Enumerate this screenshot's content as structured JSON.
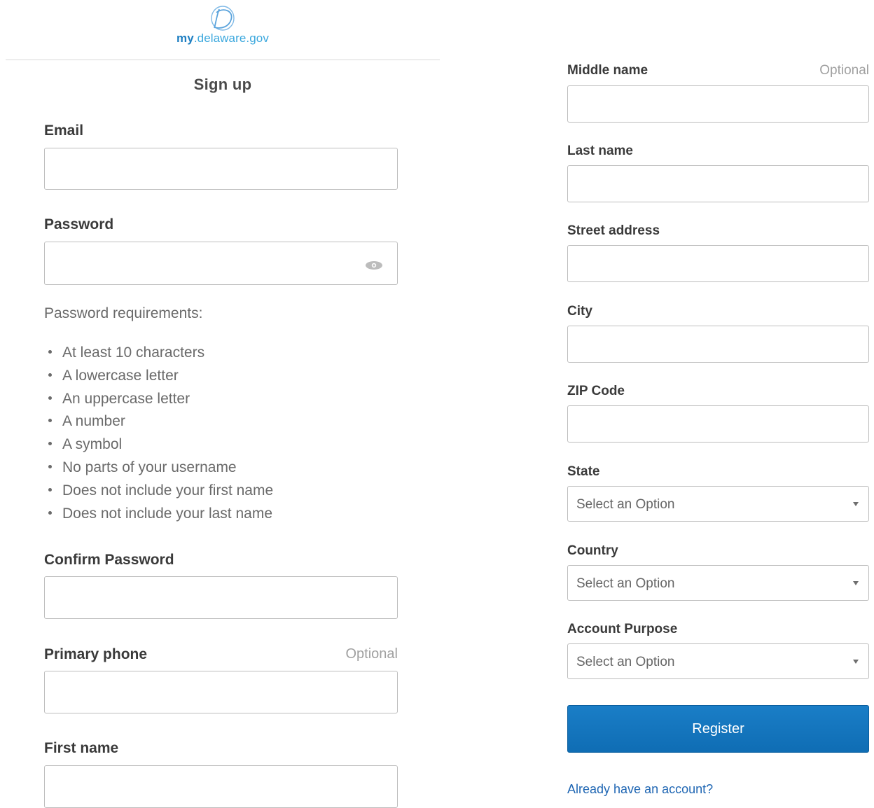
{
  "brand": {
    "logo_prefix": "my",
    "logo_domain": ".delaware.gov",
    "colors": {
      "primary": "#1f7fc2",
      "button": "#1473bb",
      "link": "#1f66b3"
    }
  },
  "form": {
    "title": "Sign up",
    "email": {
      "label": "Email",
      "value": ""
    },
    "password": {
      "label": "Password",
      "value": "",
      "toggle_icon": "eye-icon"
    },
    "password_requirements": {
      "title": "Password requirements:",
      "items": [
        "At least 10 characters",
        "A lowercase letter",
        "An uppercase letter",
        "A number",
        "A symbol",
        "No parts of your username",
        "Does not include your first name",
        "Does not include your last name"
      ]
    },
    "confirm_password": {
      "label": "Confirm Password",
      "value": ""
    },
    "primary_phone": {
      "label": "Primary phone",
      "optional": "Optional",
      "value": ""
    },
    "first_name": {
      "label": "First name",
      "value": ""
    },
    "middle_name": {
      "label": "Middle name",
      "optional": "Optional",
      "value": ""
    },
    "last_name": {
      "label": "Last name",
      "value": ""
    },
    "street_address": {
      "label": "Street address",
      "value": ""
    },
    "city": {
      "label": "City",
      "value": ""
    },
    "zip_code": {
      "label": "ZIP Code",
      "value": ""
    },
    "state": {
      "label": "State",
      "selected": "Select an Option"
    },
    "country": {
      "label": "Country",
      "selected": "Select an Option"
    },
    "account_purpose": {
      "label": "Account Purpose",
      "selected": "Select an Option"
    },
    "register_label": "Register",
    "signin_link": "Already have an account?"
  }
}
